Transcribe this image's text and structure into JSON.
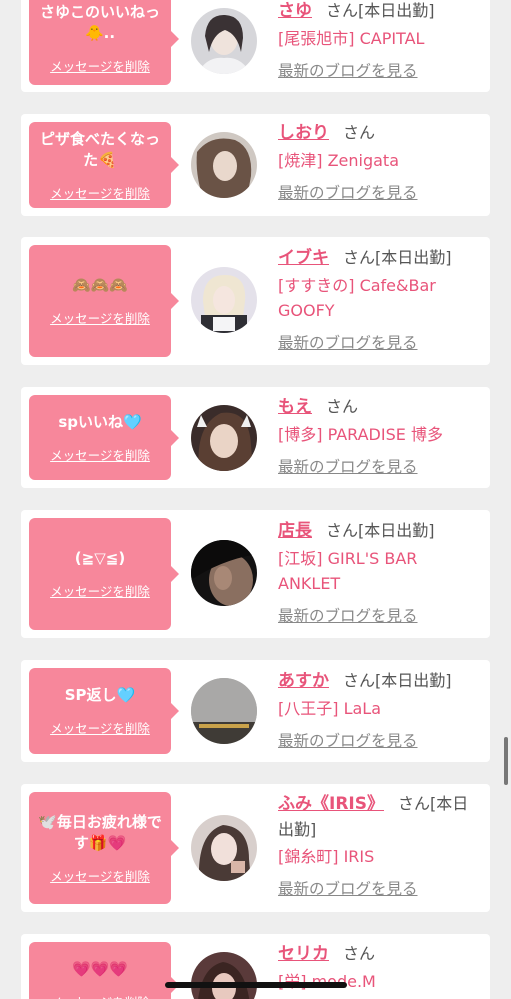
{
  "suffix": "さん",
  "delete_label": "メッセージを削除",
  "blog_label": "最新のブログを見る",
  "cards": [
    {
      "message": "さゆこのいいねっ🐥..",
      "name": "さゆ",
      "status": "[本日出勤]",
      "shop": "[尾張旭市] CAPITAL"
    },
    {
      "message": "ピザ食べたくなった🍕",
      "name": "しおり",
      "status": "",
      "shop": "[焼津] Zenigata"
    },
    {
      "message": "🙈🙈🙈",
      "name": "イブキ",
      "status": "[本日出勤]",
      "shop": "[すすきの] Cafe&Bar GOOFY"
    },
    {
      "message": "spいいね🩵",
      "name": "もえ",
      "status": "",
      "shop": "[博多] PARADISE 博多"
    },
    {
      "message": "(≧▽≦)",
      "name": "店長",
      "status": "[本日出勤]",
      "shop": "[江坂] GIRL'S BAR ANKLET"
    },
    {
      "message": "SP返し🩵",
      "name": "あすか",
      "status": "[本日出勤]",
      "shop": "[八王子] LaLa"
    },
    {
      "message": "🕊️毎日お疲れ様です🎁💗",
      "name": "ふみ《IRIS》",
      "status": "[本日出勤]",
      "shop": "[錦糸町] IRIS"
    },
    {
      "message": "💗💗💗",
      "name": "セリカ",
      "status": "",
      "shop": "[栄] mode.M"
    }
  ],
  "colors": {
    "background": "#eeeeee",
    "bubble": "#f7879b",
    "name": "#e8547a",
    "shop": "#e8547a",
    "blog_link": "#888888"
  }
}
